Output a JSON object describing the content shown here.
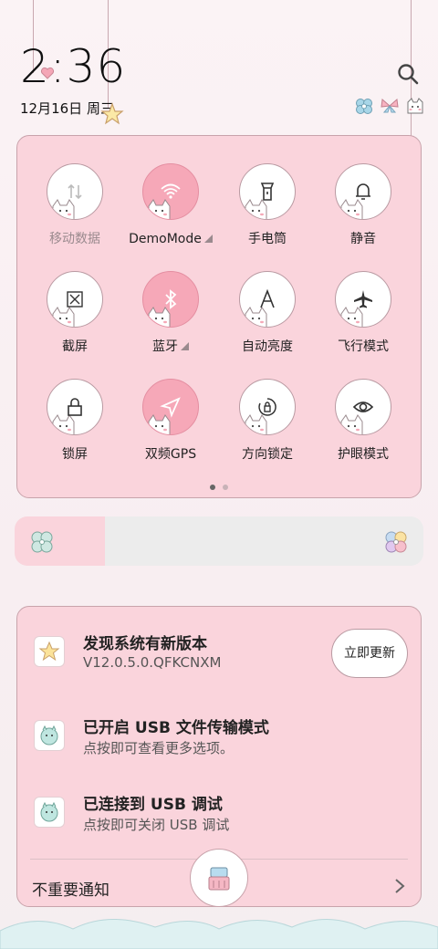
{
  "status": {
    "time": "2:36",
    "date": "12月16日 周三"
  },
  "icons": {
    "search": "search-icon",
    "top_decorations": [
      "flower-icon",
      "butterfly-icon",
      "cat-icon"
    ]
  },
  "control_center": {
    "tiles": [
      {
        "id": "mobile-data",
        "label": "移动数据",
        "icon": "mobile-data-icon",
        "active": false,
        "dimmed": true,
        "has_menu": false
      },
      {
        "id": "wifi",
        "label": "DemoMode",
        "icon": "wifi-icon",
        "active": true,
        "dimmed": false,
        "has_menu": true
      },
      {
        "id": "flashlight",
        "label": "手电筒",
        "icon": "flashlight-icon",
        "active": false,
        "dimmed": false,
        "has_menu": false
      },
      {
        "id": "mute",
        "label": "静音",
        "icon": "bell-icon",
        "active": false,
        "dimmed": false,
        "has_menu": false
      },
      {
        "id": "screenshot",
        "label": "截屏",
        "icon": "screenshot-icon",
        "active": false,
        "dimmed": false,
        "has_menu": false
      },
      {
        "id": "bluetooth",
        "label": "蓝牙",
        "icon": "bluetooth-icon",
        "active": true,
        "dimmed": false,
        "has_menu": true
      },
      {
        "id": "auto-brightness",
        "label": "自动亮度",
        "icon": "auto-brightness-icon",
        "active": false,
        "dimmed": false,
        "has_menu": false
      },
      {
        "id": "airplane",
        "label": "飞行模式",
        "icon": "airplane-icon",
        "active": false,
        "dimmed": false,
        "has_menu": false
      },
      {
        "id": "lock",
        "label": "锁屏",
        "icon": "lock-icon",
        "active": false,
        "dimmed": false,
        "has_menu": false
      },
      {
        "id": "gps",
        "label": "双频GPS",
        "icon": "location-icon",
        "active": true,
        "dimmed": false,
        "has_menu": false
      },
      {
        "id": "rotation-lock",
        "label": "方向锁定",
        "icon": "rotation-lock-icon",
        "active": false,
        "dimmed": false,
        "has_menu": false
      },
      {
        "id": "eye-care",
        "label": "护眼模式",
        "icon": "eye-icon",
        "active": false,
        "dimmed": false,
        "has_menu": false
      }
    ],
    "pages": 2,
    "current_page": 1
  },
  "brightness": {
    "level": 0.22
  },
  "notifications": [
    {
      "title": "发现系统有新版本",
      "subtitle": "V12.0.5.0.QFKCNXM",
      "icon": "update-star-icon",
      "action": "立即更新"
    },
    {
      "title": "已开启 USB 文件传输模式",
      "subtitle": "点按即可查看更多选项。",
      "icon": "usb-cat-icon"
    },
    {
      "title": "已连接到 USB 调试",
      "subtitle": "点按即可关闭 USB 调试",
      "icon": "usb-cat-icon"
    }
  ],
  "footer": {
    "label": "不重要通知"
  },
  "colors": {
    "panel_bg": "#fad4dc",
    "active_tile": "#f6a8b8",
    "border": "#c8a3ab"
  }
}
